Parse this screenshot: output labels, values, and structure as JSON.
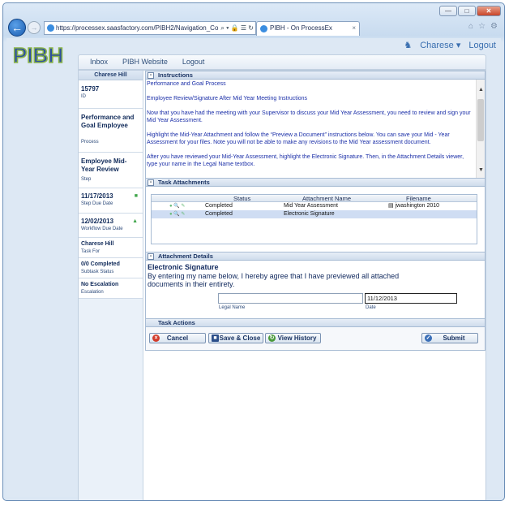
{
  "browser": {
    "url": "https://processex.saasfactory.com/PIBH2/Navigation_Co",
    "tab_title": "PIBH - On ProcessEx",
    "address_tools": "⌕ ▾ 🔒 ☰ ↻",
    "min": "—",
    "max": "□",
    "close": "✕"
  },
  "app": {
    "logo": "PIBH",
    "user": "Charese",
    "logout": "Logout",
    "menu": [
      "Inbox",
      "PIBH Website",
      "Logout"
    ]
  },
  "sidebar": {
    "header": "Charese Hill",
    "items": [
      {
        "value": "15797",
        "label": "ID"
      },
      {
        "value": "Performance and Goal Employee",
        "label": "Process"
      },
      {
        "value": "Employee Mid-Year Review",
        "label": "Step"
      },
      {
        "value": "11/17/2013",
        "label": "Step Due Date"
      },
      {
        "value": "12/02/2013",
        "label": "Workflow Due Date"
      },
      {
        "value": "Charese Hill",
        "label": "Task For"
      },
      {
        "value": "0/0 Completed",
        "label": "Subtask Status"
      },
      {
        "value": "No Escalation",
        "label": "Escalation"
      }
    ]
  },
  "sections": {
    "instructions": "Instructions",
    "attachments": "Task Attachments",
    "details": "Attachment Details",
    "actions": "Task Actions"
  },
  "instructions": {
    "p1": "Performance and Goal Process",
    "p2": "Employee Review/Signature After Mid Year Meeting Instructions",
    "p3": "Now that you have had the meeting with your Supervisor to discuss your Mid Year Assessment, you need to review and sign your Mid Year Assessment.",
    "p4": "Highlight the Mid-Year Attachment and follow the “Preview a Document” instructions below.  You can save your Mid - Year Assessment for your files.  Note you will not be able to make any revisions to the Mid Year assessment document.",
    "p5": "After you have reviewed your Mid-Year Assessment, highlight the Electronic Signature.  Then, in the Attachment Details viewer, type your name in the Legal Name textbox."
  },
  "attachments": {
    "headers": {
      "status": "Status",
      "name": "Attachment Name",
      "file": "Filename"
    },
    "rows": [
      {
        "status": "Completed",
        "name": "Mid Year Assessment",
        "file": "jwashington 2010"
      },
      {
        "status": "Completed",
        "name": "Electronic Signature",
        "file": ""
      }
    ]
  },
  "details": {
    "title": "Electronic Signature",
    "text": "By entering my name below, I hereby agree that I have previewed all attached documents in their entirety.",
    "legal_label": "Legal Name",
    "date_label": "Date",
    "legal_value": "",
    "date_value": "11/12/2013"
  },
  "buttons": {
    "cancel": "Cancel",
    "save": "Save & Close",
    "history": "View History",
    "submit": "Submit"
  }
}
